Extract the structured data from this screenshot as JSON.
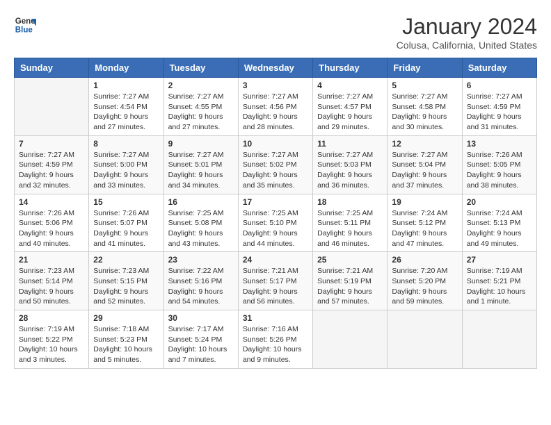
{
  "header": {
    "logo_line1": "General",
    "logo_line2": "Blue",
    "month": "January 2024",
    "location": "Colusa, California, United States"
  },
  "weekdays": [
    "Sunday",
    "Monday",
    "Tuesday",
    "Wednesday",
    "Thursday",
    "Friday",
    "Saturday"
  ],
  "weeks": [
    [
      {
        "day": "",
        "info": ""
      },
      {
        "day": "1",
        "info": "Sunrise: 7:27 AM\nSunset: 4:54 PM\nDaylight: 9 hours\nand 27 minutes."
      },
      {
        "day": "2",
        "info": "Sunrise: 7:27 AM\nSunset: 4:55 PM\nDaylight: 9 hours\nand 27 minutes."
      },
      {
        "day": "3",
        "info": "Sunrise: 7:27 AM\nSunset: 4:56 PM\nDaylight: 9 hours\nand 28 minutes."
      },
      {
        "day": "4",
        "info": "Sunrise: 7:27 AM\nSunset: 4:57 PM\nDaylight: 9 hours\nand 29 minutes."
      },
      {
        "day": "5",
        "info": "Sunrise: 7:27 AM\nSunset: 4:58 PM\nDaylight: 9 hours\nand 30 minutes."
      },
      {
        "day": "6",
        "info": "Sunrise: 7:27 AM\nSunset: 4:59 PM\nDaylight: 9 hours\nand 31 minutes."
      }
    ],
    [
      {
        "day": "7",
        "info": "Sunrise: 7:27 AM\nSunset: 4:59 PM\nDaylight: 9 hours\nand 32 minutes."
      },
      {
        "day": "8",
        "info": "Sunrise: 7:27 AM\nSunset: 5:00 PM\nDaylight: 9 hours\nand 33 minutes."
      },
      {
        "day": "9",
        "info": "Sunrise: 7:27 AM\nSunset: 5:01 PM\nDaylight: 9 hours\nand 34 minutes."
      },
      {
        "day": "10",
        "info": "Sunrise: 7:27 AM\nSunset: 5:02 PM\nDaylight: 9 hours\nand 35 minutes."
      },
      {
        "day": "11",
        "info": "Sunrise: 7:27 AM\nSunset: 5:03 PM\nDaylight: 9 hours\nand 36 minutes."
      },
      {
        "day": "12",
        "info": "Sunrise: 7:27 AM\nSunset: 5:04 PM\nDaylight: 9 hours\nand 37 minutes."
      },
      {
        "day": "13",
        "info": "Sunrise: 7:26 AM\nSunset: 5:05 PM\nDaylight: 9 hours\nand 38 minutes."
      }
    ],
    [
      {
        "day": "14",
        "info": "Sunrise: 7:26 AM\nSunset: 5:06 PM\nDaylight: 9 hours\nand 40 minutes."
      },
      {
        "day": "15",
        "info": "Sunrise: 7:26 AM\nSunset: 5:07 PM\nDaylight: 9 hours\nand 41 minutes."
      },
      {
        "day": "16",
        "info": "Sunrise: 7:25 AM\nSunset: 5:08 PM\nDaylight: 9 hours\nand 43 minutes."
      },
      {
        "day": "17",
        "info": "Sunrise: 7:25 AM\nSunset: 5:10 PM\nDaylight: 9 hours\nand 44 minutes."
      },
      {
        "day": "18",
        "info": "Sunrise: 7:25 AM\nSunset: 5:11 PM\nDaylight: 9 hours\nand 46 minutes."
      },
      {
        "day": "19",
        "info": "Sunrise: 7:24 AM\nSunset: 5:12 PM\nDaylight: 9 hours\nand 47 minutes."
      },
      {
        "day": "20",
        "info": "Sunrise: 7:24 AM\nSunset: 5:13 PM\nDaylight: 9 hours\nand 49 minutes."
      }
    ],
    [
      {
        "day": "21",
        "info": "Sunrise: 7:23 AM\nSunset: 5:14 PM\nDaylight: 9 hours\nand 50 minutes."
      },
      {
        "day": "22",
        "info": "Sunrise: 7:23 AM\nSunset: 5:15 PM\nDaylight: 9 hours\nand 52 minutes."
      },
      {
        "day": "23",
        "info": "Sunrise: 7:22 AM\nSunset: 5:16 PM\nDaylight: 9 hours\nand 54 minutes."
      },
      {
        "day": "24",
        "info": "Sunrise: 7:21 AM\nSunset: 5:17 PM\nDaylight: 9 hours\nand 56 minutes."
      },
      {
        "day": "25",
        "info": "Sunrise: 7:21 AM\nSunset: 5:19 PM\nDaylight: 9 hours\nand 57 minutes."
      },
      {
        "day": "26",
        "info": "Sunrise: 7:20 AM\nSunset: 5:20 PM\nDaylight: 9 hours\nand 59 minutes."
      },
      {
        "day": "27",
        "info": "Sunrise: 7:19 AM\nSunset: 5:21 PM\nDaylight: 10 hours\nand 1 minute."
      }
    ],
    [
      {
        "day": "28",
        "info": "Sunrise: 7:19 AM\nSunset: 5:22 PM\nDaylight: 10 hours\nand 3 minutes."
      },
      {
        "day": "29",
        "info": "Sunrise: 7:18 AM\nSunset: 5:23 PM\nDaylight: 10 hours\nand 5 minutes."
      },
      {
        "day": "30",
        "info": "Sunrise: 7:17 AM\nSunset: 5:24 PM\nDaylight: 10 hours\nand 7 minutes."
      },
      {
        "day": "31",
        "info": "Sunrise: 7:16 AM\nSunset: 5:26 PM\nDaylight: 10 hours\nand 9 minutes."
      },
      {
        "day": "",
        "info": ""
      },
      {
        "day": "",
        "info": ""
      },
      {
        "day": "",
        "info": ""
      }
    ]
  ]
}
